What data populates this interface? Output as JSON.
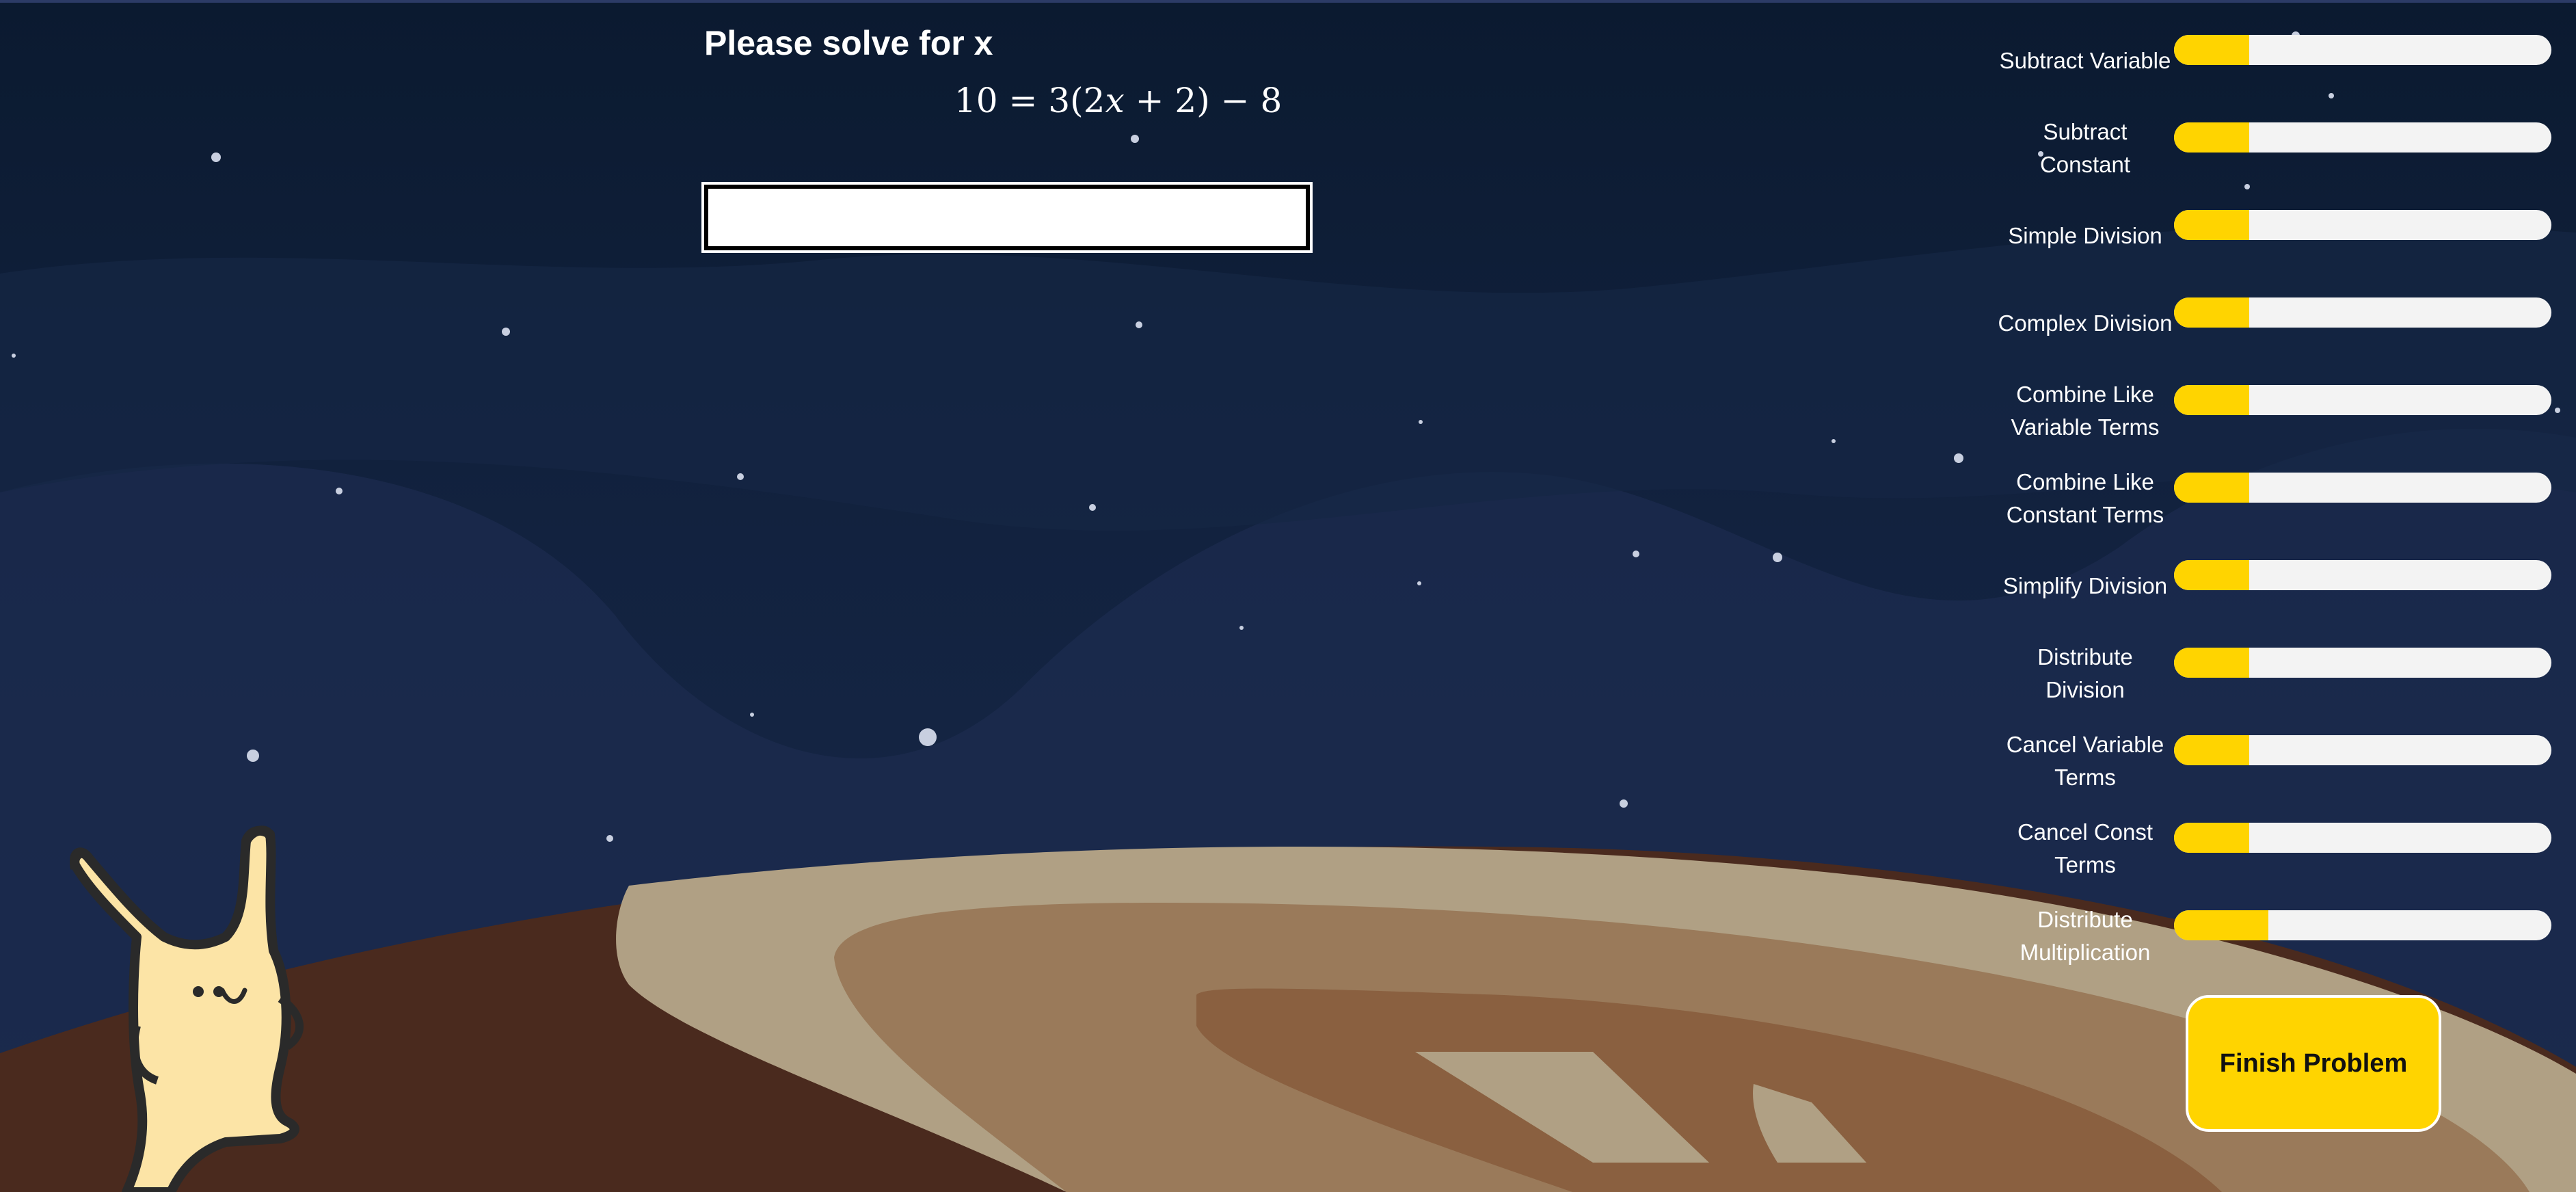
{
  "problem": {
    "title": "Please solve for x",
    "equation": {
      "lhs": "10",
      "equals": "=",
      "coef": "3",
      "open": "(",
      "term": "2",
      "var": "x",
      "plus": "+",
      "const": "2",
      "close": ")",
      "minus": "−",
      "last": "8"
    },
    "answer_value": "",
    "answer_placeholder": ""
  },
  "skills": [
    {
      "label": "Subtract Variable",
      "progress": 0.2
    },
    {
      "label": "Subtract Constant",
      "progress": 0.2
    },
    {
      "label": "Simple Division",
      "progress": 0.2
    },
    {
      "label": "Complex Division",
      "progress": 0.2
    },
    {
      "label": "Combine Like Variable Terms",
      "progress": 0.2
    },
    {
      "label": "Combine Like Constant Terms",
      "progress": 0.2
    },
    {
      "label": "Simplify Division",
      "progress": 0.2
    },
    {
      "label": "Distribute Division",
      "progress": 0.2
    },
    {
      "label": "Cancel Variable Terms",
      "progress": 0.2
    },
    {
      "label": "Cancel Const Terms",
      "progress": 0.2
    },
    {
      "label": "Distribute Multiplication",
      "progress": 0.25
    }
  ],
  "finish_button": {
    "label": "Finish Problem"
  },
  "colors": {
    "accent": "#ffd400",
    "sky": "#112140",
    "planet_dark": "#4a2a1e",
    "planet_ring": "#b0a084",
    "mascot": "#fce4a6"
  },
  "decor": {
    "mascot_icon": "smiling-alien-mascot",
    "planet_icon": "planet-surface"
  }
}
